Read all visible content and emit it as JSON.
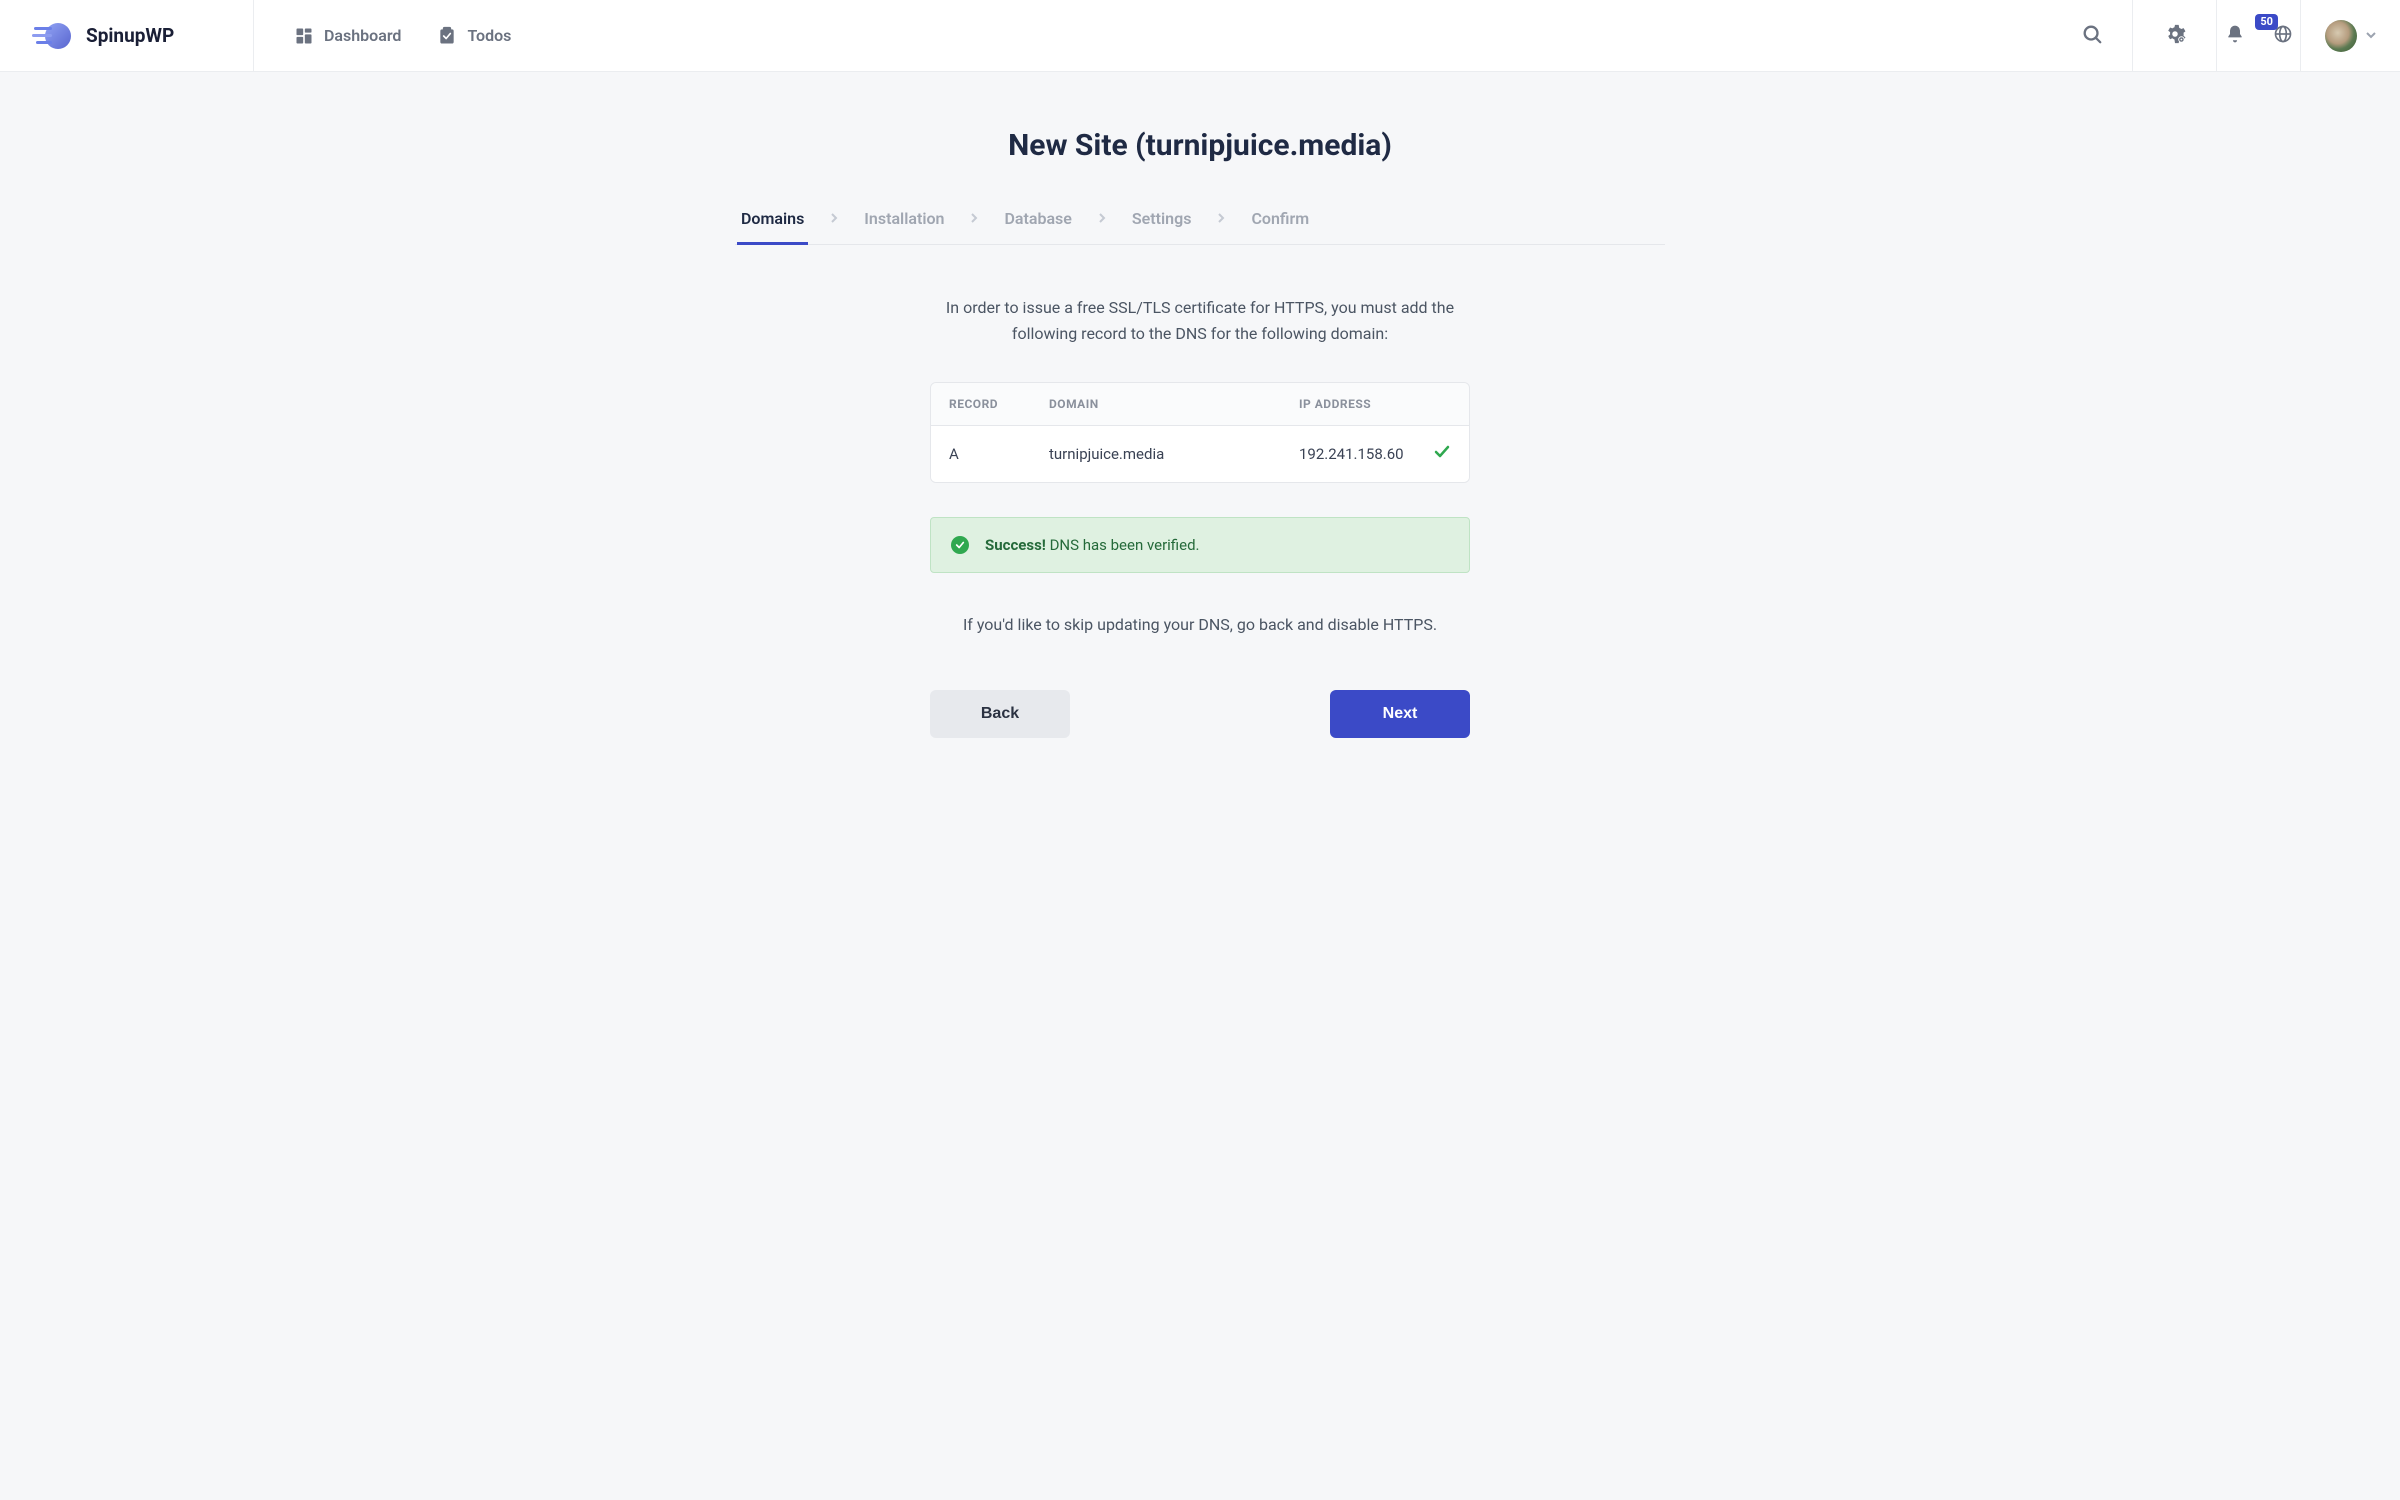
{
  "brand": {
    "name": "SpinupWP"
  },
  "nav": {
    "dashboard": "Dashboard",
    "todos": "Todos"
  },
  "header": {
    "notification_count": "50"
  },
  "page": {
    "title": "New Site (turnipjuice.media)"
  },
  "stepper": {
    "domains": "Domains",
    "installation": "Installation",
    "database": "Database",
    "settings": "Settings",
    "confirm": "Confirm"
  },
  "dns": {
    "intro": "In order to issue a free SSL/TLS certificate for HTTPS, you must add the following record to the DNS for the following domain:",
    "headers": {
      "record": "RECORD",
      "domain": "DOMAIN",
      "ip": "IP ADDRESS"
    },
    "row": {
      "record": "A",
      "domain": "turnipjuice.media",
      "ip": "192.241.158.60"
    },
    "success_strong": "Success!",
    "success_rest": " DNS has been verified.",
    "skip": "If you'd like to skip updating your DNS, go back and disable HTTPS."
  },
  "buttons": {
    "back": "Back",
    "next": "Next"
  }
}
